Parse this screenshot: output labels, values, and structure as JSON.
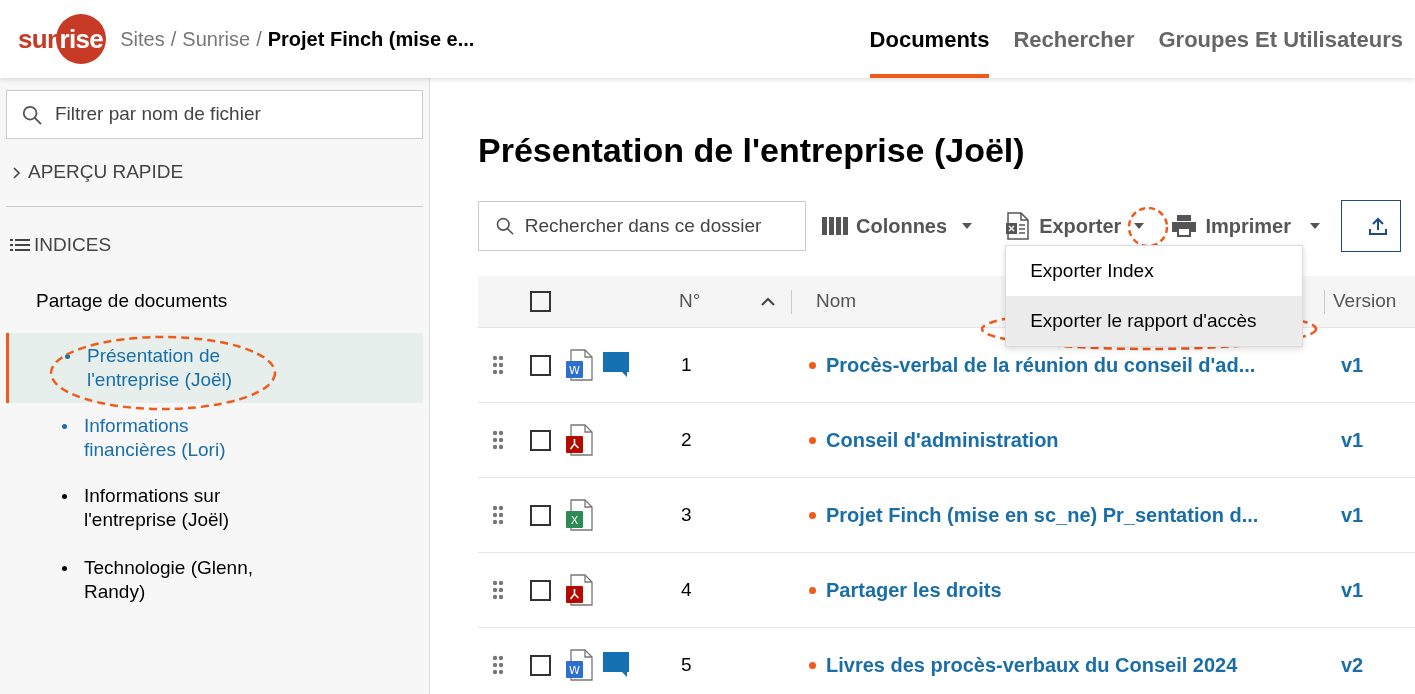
{
  "header": {
    "logo": {
      "part_1": "sun",
      "part_2": "rise"
    },
    "breadcrumb": [
      {
        "label": "Sites",
        "current": false
      },
      {
        "label": "Sunrise",
        "current": false
      },
      {
        "label": "Projet Finch (mise e...",
        "current": true
      }
    ],
    "separator": "/",
    "tabs": [
      {
        "label": "Documents",
        "selected": true
      },
      {
        "label": "Rechercher",
        "selected": false
      },
      {
        "label": "Groupes Et Utilisateurs",
        "selected": false
      }
    ]
  },
  "sidebar": {
    "filter": {
      "placeholder": "Filtrer par nom de fichier"
    },
    "quick_view": {
      "label": "APERÇU RAPIDE",
      "expanded": false
    },
    "indices_label": "INDICES",
    "tree": [
      {
        "label": "Partage de documents",
        "children": [
          {
            "label": "Présentation de l'entreprise (Joël)",
            "selected": true,
            "linked": true
          },
          {
            "label": "Informations financières (Lori)",
            "selected": false,
            "linked": true
          },
          {
            "label": "Informations sur l'entreprise (Joël)",
            "selected": false,
            "linked": false
          },
          {
            "label": "Technologie (Glenn, Randy)",
            "selected": false,
            "linked": false
          }
        ]
      }
    ]
  },
  "main": {
    "title": "Présentation de l'entreprise (Joël)",
    "toolbar": {
      "search": {
        "placeholder": "Rechercher dans ce dossier"
      },
      "columns_button": "Colonnes",
      "export_button": "Exporter",
      "print_button": "Imprimer",
      "export_menu": {
        "items": [
          {
            "label": "Exporter Index",
            "selected": false
          },
          {
            "label": "Exporter le rapport d'accès",
            "selected": true
          }
        ]
      }
    },
    "table": {
      "columns": [
        {
          "label": "N°",
          "sorted": true
        },
        {
          "label": "Nom"
        },
        {
          "label": "Version"
        }
      ],
      "select_all": false,
      "rows": [
        {
          "number": "1",
          "name": "Procès-verbal de la réunion du conseil d'ad...",
          "version": "v1",
          "kind": "word",
          "letter": "W",
          "comments": true,
          "checked": false
        },
        {
          "number": "2",
          "name": "Conseil d'administration",
          "version": "v1",
          "kind": "pdf",
          "comments": false,
          "checked": false
        },
        {
          "number": "3",
          "name": "Projet Finch (mise en sc_ne) Pr_sentation d...",
          "version": "v1",
          "kind": "excel",
          "letter": "X",
          "comments": false,
          "checked": false
        },
        {
          "number": "4",
          "name": "Partager les droits",
          "version": "v1",
          "kind": "pdf",
          "comments": false,
          "checked": false
        },
        {
          "number": "5",
          "name": "Livres des procès-verbaux du Conseil 2024",
          "version": "v2",
          "kind": "word",
          "letter": "W",
          "comments": true,
          "checked": false
        }
      ]
    }
  }
}
